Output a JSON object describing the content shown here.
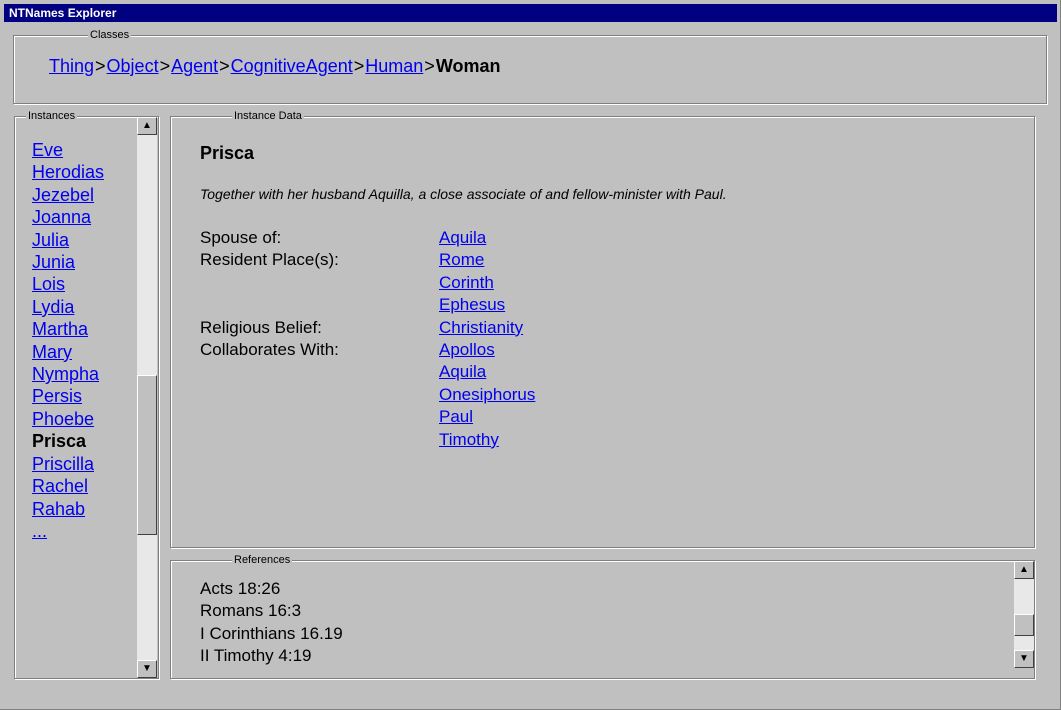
{
  "window": {
    "title": "NTNames Explorer"
  },
  "classes": {
    "title": "Classes",
    "path": [
      {
        "label": "Thing",
        "sep": ">"
      },
      {
        "label": "Object",
        "sep": ">"
      },
      {
        "label": "Agent",
        "sep": ">"
      },
      {
        "label": "CognitiveAgent",
        "sep": ">"
      },
      {
        "label": "Human",
        "sep": ">"
      },
      {
        "label": "Woman"
      }
    ]
  },
  "instances": {
    "title": "Instances",
    "items": [
      "Eve",
      "Herodias",
      "Jezebel",
      "Joanna",
      "Julia",
      "Junia",
      "Lois",
      "Lydia",
      "Martha",
      "Mary",
      "Nympha",
      "Persis",
      "Phoebe",
      "Prisca",
      "Priscilla",
      "Rachel",
      "Rahab",
      "..."
    ],
    "selected": "Prisca"
  },
  "instance_data": {
    "title": "Instance Data",
    "name": "Prisca",
    "description": "Together with her husband Aquilla, a close associate of and fellow-minister with Paul.",
    "properties": [
      {
        "label": "Spouse of:",
        "values": [
          "Aquila"
        ]
      },
      {
        "label": "Resident Place(s):",
        "values": [
          "Rome",
          "Corinth",
          "Ephesus"
        ]
      },
      {
        "label": "Religious Belief:",
        "values": [
          "Christianity"
        ]
      },
      {
        "label": "Collaborates With:",
        "values": [
          "Apollos",
          "Aquila",
          "Onesiphorus",
          "Paul",
          "Timothy"
        ]
      }
    ]
  },
  "references": {
    "title": "References",
    "items": [
      "Acts 18:26",
      "Romans 16:3",
      "I Corinthians 16.19",
      "II Timothy 4:19"
    ]
  },
  "icons": {
    "scroll_up": "▲",
    "scroll_down": "▼"
  }
}
